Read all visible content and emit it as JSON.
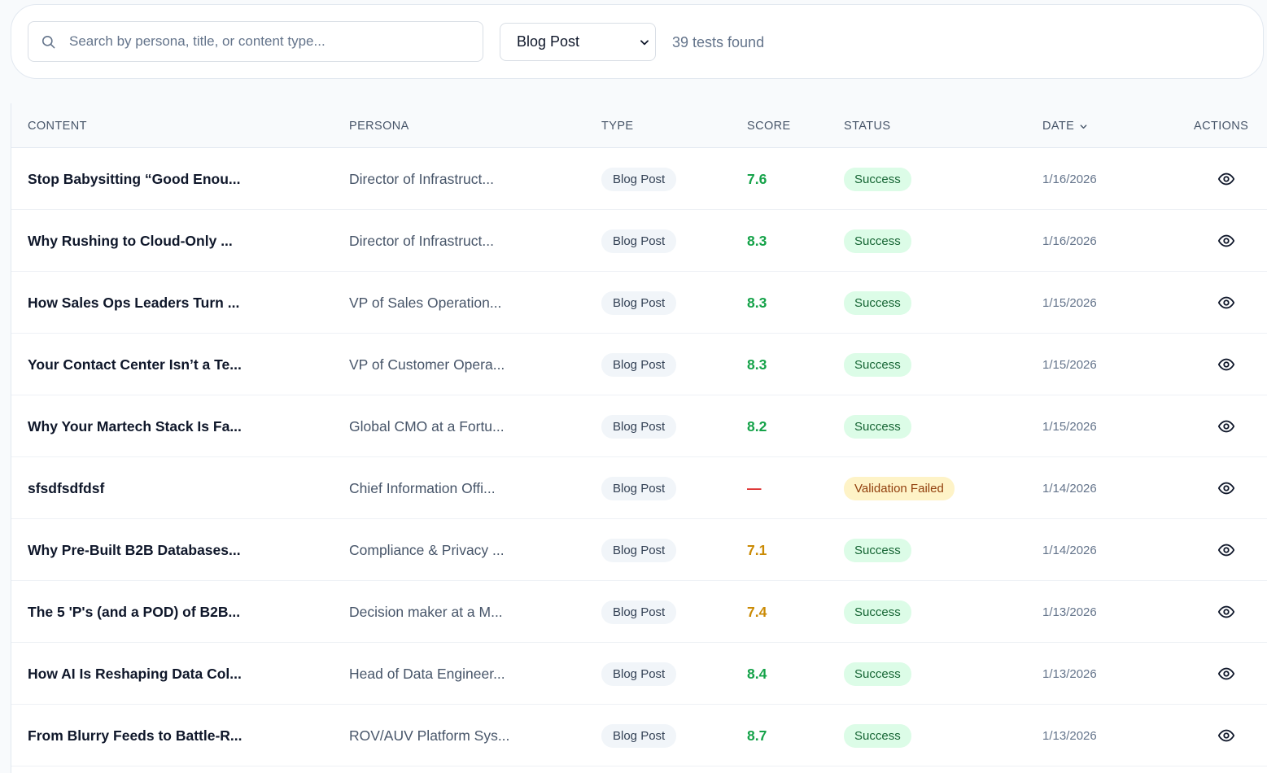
{
  "filters": {
    "search_placeholder": "Search by persona, title, or content type...",
    "type_selected": "Blog Post",
    "count_text": "39 tests found"
  },
  "table": {
    "headers": {
      "content": "CONTENT",
      "persona": "PERSONA",
      "type": "TYPE",
      "score": "SCORE",
      "status": "STATUS",
      "date": "DATE",
      "actions": "ACTIONS"
    },
    "rows": [
      {
        "content": "Stop Babysitting “Good Enou...",
        "persona": "Director of Infrastruct...",
        "type": "Blog Post",
        "score": "7.6",
        "score_color": "#16a34a",
        "status": "Success",
        "status_kind": "success",
        "date": "1/16/2026"
      },
      {
        "content": "Why Rushing to Cloud-Only ...",
        "persona": "Director of Infrastruct...",
        "type": "Blog Post",
        "score": "8.3",
        "score_color": "#16a34a",
        "status": "Success",
        "status_kind": "success",
        "date": "1/16/2026"
      },
      {
        "content": "How Sales Ops Leaders Turn ...",
        "persona": "VP of Sales Operation...",
        "type": "Blog Post",
        "score": "8.3",
        "score_color": "#16a34a",
        "status": "Success",
        "status_kind": "success",
        "date": "1/15/2026"
      },
      {
        "content": "Your Contact Center Isn’t a Te...",
        "persona": "VP of Customer Opera...",
        "type": "Blog Post",
        "score": "8.3",
        "score_color": "#16a34a",
        "status": "Success",
        "status_kind": "success",
        "date": "1/15/2026"
      },
      {
        "content": "Why Your Martech Stack Is Fa...",
        "persona": "Global CMO at a Fortu...",
        "type": "Blog Post",
        "score": "8.2",
        "score_color": "#16a34a",
        "status": "Success",
        "status_kind": "success",
        "date": "1/15/2026"
      },
      {
        "content": "sfsdfsdfdsf",
        "persona": "Chief Information Offi...",
        "type": "Blog Post",
        "score": "—",
        "score_color": "#dc2626",
        "status": "Validation Failed",
        "status_kind": "failed",
        "date": "1/14/2026"
      },
      {
        "content": "Why Pre-Built B2B Databases...",
        "persona": "Compliance & Privacy ...",
        "type": "Blog Post",
        "score": "7.1",
        "score_color": "#ca8a04",
        "status": "Success",
        "status_kind": "success",
        "date": "1/14/2026"
      },
      {
        "content": "The 5 'P's (and a POD) of B2B...",
        "persona": "Decision maker at a M...",
        "type": "Blog Post",
        "score": "7.4",
        "score_color": "#ca8a04",
        "status": "Success",
        "status_kind": "success",
        "date": "1/13/2026"
      },
      {
        "content": "How AI Is Reshaping Data Col...",
        "persona": "Head of Data Engineer...",
        "type": "Blog Post",
        "score": "8.4",
        "score_color": "#16a34a",
        "status": "Success",
        "status_kind": "success",
        "date": "1/13/2026"
      },
      {
        "content": "From Blurry Feeds to Battle-R...",
        "persona": "ROV/AUV Platform Sys...",
        "type": "Blog Post",
        "score": "8.7",
        "score_color": "#16a34a",
        "status": "Success",
        "status_kind": "success",
        "date": "1/13/2026"
      }
    ]
  }
}
